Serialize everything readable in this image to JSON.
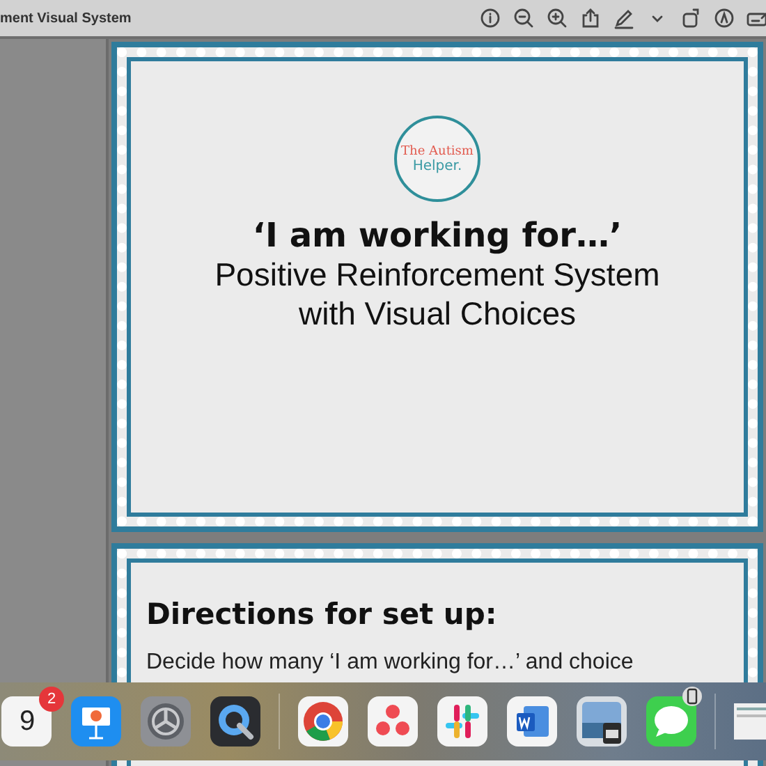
{
  "window": {
    "title": "ment Visual System"
  },
  "toolbar": {
    "buttons": [
      {
        "kind": "info"
      },
      {
        "kind": "zoom-out"
      },
      {
        "kind": "zoom-in"
      },
      {
        "kind": "share"
      },
      {
        "kind": "pen"
      },
      {
        "kind": "chevron"
      },
      {
        "kind": "rotate"
      },
      {
        "kind": "markup"
      },
      {
        "kind": "form"
      }
    ]
  },
  "pages": [
    {
      "logo": {
        "line_1": "The Autism",
        "line_2": "Helper."
      },
      "heading": "‘I am working for…’",
      "subtitle": [
        "Positive Reinforcement System",
        "with Visual Choices"
      ]
    },
    {
      "heading": "Directions for set up:",
      "paragraph": "Decide how many ‘I am working for…’ and choice"
    }
  ],
  "dock": {
    "items": [
      {
        "kind": "calendar",
        "text": "9",
        "badge": "2"
      },
      {
        "kind": "presentation"
      },
      {
        "kind": "gear"
      },
      {
        "kind": "player"
      },
      {
        "kind": "separator"
      },
      {
        "kind": "browser"
      },
      {
        "kind": "dots"
      },
      {
        "kind": "hash"
      },
      {
        "kind": "document"
      },
      {
        "kind": "viewer"
      },
      {
        "kind": "chat"
      },
      {
        "kind": "separator"
      },
      {
        "kind": "thumbnail"
      }
    ]
  }
}
